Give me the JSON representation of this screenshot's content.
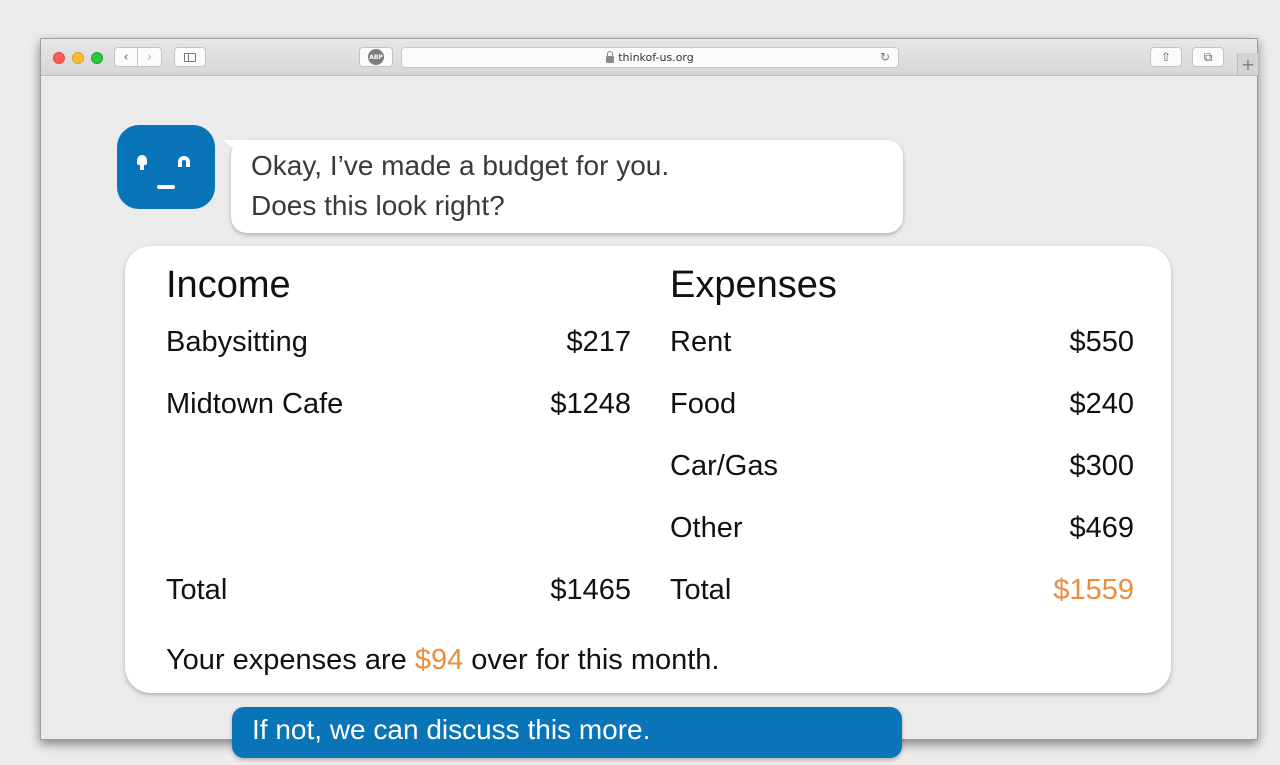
{
  "browser": {
    "url": "thinkof-us.org",
    "abp_label": "ABP",
    "icons": {
      "back": "chevron-left-icon",
      "forward": "chevron-right-icon",
      "sidebar": "sidebar-icon",
      "lock": "lock-icon",
      "reload": "reload-icon",
      "share": "share-icon",
      "tabs": "tabs-icon",
      "new_tab": "plus-icon"
    },
    "new_tab_label": "+"
  },
  "chat": {
    "bot_message": [
      "Okay, I’ve made a budget for you.",
      "Does this look right?"
    ],
    "reply_message": "If not, we can discuss this more."
  },
  "budget": {
    "income": {
      "title": "Income",
      "items": [
        {
          "label": "Babysitting",
          "amount": "$217"
        },
        {
          "label": "Midtown Cafe",
          "amount": "$1248"
        }
      ],
      "total_label": "Total",
      "total_amount": "$1465"
    },
    "expenses": {
      "title": "Expenses",
      "items": [
        {
          "label": "Rent",
          "amount": "$550"
        },
        {
          "label": "Food",
          "amount": "$240"
        },
        {
          "label": "Car/Gas",
          "amount": "$300"
        },
        {
          "label": "Other",
          "amount": "$469"
        }
      ],
      "total_label": "Total",
      "total_amount": "$1559"
    },
    "summary": {
      "prefix": "Your expenses are ",
      "amount": "$94",
      "suffix": " over for this month."
    }
  },
  "colors": {
    "brand_blue": "#0a74b8",
    "warning_orange": "#ec8d3c"
  }
}
